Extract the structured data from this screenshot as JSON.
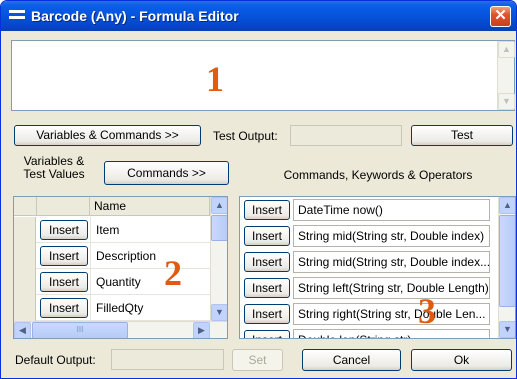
{
  "window": {
    "title": "Barcode (Any) - Formula Editor",
    "close_glyph": "✕"
  },
  "editor": {
    "annotation": "1"
  },
  "toolbar": {
    "variables_commands_label": "Variables & Commands >>",
    "test_output_label": "Test Output:",
    "test_output_value": "",
    "test_label": "Test"
  },
  "left_panel": {
    "heading": "Variables & Test Values",
    "commands_button": "Commands >>",
    "column_name": "Name",
    "insert_label": "Insert",
    "rows": [
      "Item",
      "Description",
      "Quantity",
      "FilledQty"
    ],
    "annotation": "2",
    "scroll_thumb_glyph": "III"
  },
  "right_panel": {
    "heading": "Commands, Keywords & Operators",
    "insert_label": "Insert",
    "rows": [
      "DateTime now()",
      "String mid(String str, Double index)",
      "String mid(String str, Double index...",
      "String left(String str, Double Length)",
      "String right(String str, Double Len...",
      "Double len(String str)"
    ],
    "annotation": "3"
  },
  "footer": {
    "default_output_label": "Default Output:",
    "default_output_value": "",
    "set_label": "Set",
    "cancel_label": "Cancel",
    "ok_label": "Ok"
  },
  "icons": {
    "up": "▲",
    "down": "▼",
    "left": "◀",
    "right": "▶"
  },
  "colors": {
    "title_bar": "#0653dc",
    "annotation": "#e05a12",
    "close_button": "#e0542a"
  }
}
